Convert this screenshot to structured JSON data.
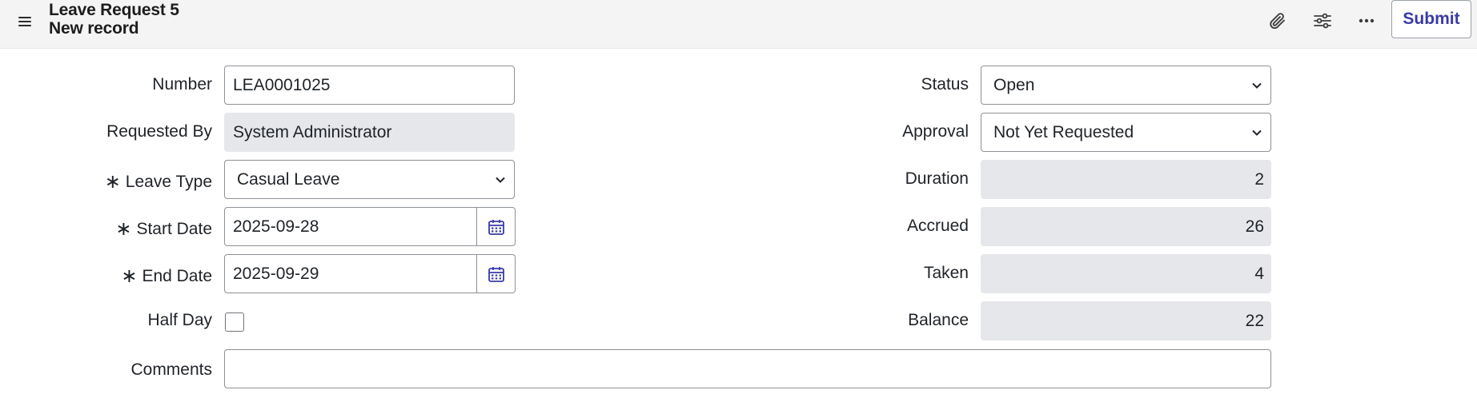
{
  "header": {
    "title": "Leave Request 5",
    "subtitle": "New record",
    "submit_label": "Submit",
    "icons": [
      "menu-icon",
      "paperclip-icon",
      "sliders-icon",
      "more-icon"
    ]
  },
  "form": {
    "number": {
      "label": "Number",
      "value": "LEA0001025"
    },
    "requested_by": {
      "label": "Requested By",
      "value": "System Administrator"
    },
    "leave_type": {
      "label": "Leave Type",
      "value": "Casual Leave",
      "required_mark": "∗"
    },
    "start_date": {
      "label": "Start Date",
      "value": "2025-09-28",
      "required_mark": "∗"
    },
    "end_date": {
      "label": "End Date",
      "value": "2025-09-29",
      "required_mark": "∗"
    },
    "half_day": {
      "label": "Half Day",
      "checked": false
    },
    "comments": {
      "label": "Comments",
      "value": ""
    },
    "status": {
      "label": "Status",
      "value": "Open"
    },
    "approval": {
      "label": "Approval",
      "value": "Not Yet Requested"
    },
    "duration": {
      "label": "Duration",
      "value": "2"
    },
    "accrued": {
      "label": "Accrued",
      "value": "26"
    },
    "taken": {
      "label": "Taken",
      "value": "4"
    },
    "balance": {
      "label": "Balance",
      "value": "22"
    }
  },
  "colors": {
    "accent": "#3a3aa8",
    "header_bg": "#f4f4f4",
    "readonly_bg": "#e6e7ea"
  }
}
